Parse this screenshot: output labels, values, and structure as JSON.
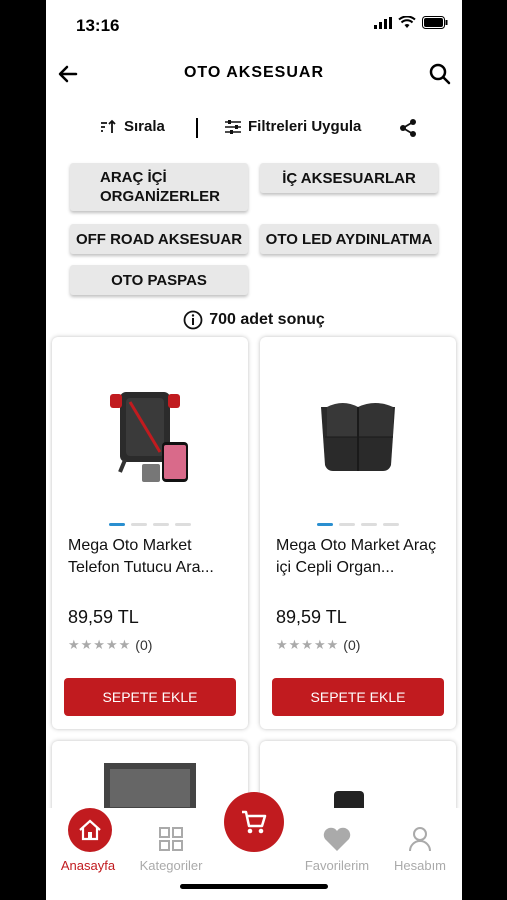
{
  "status": {
    "time": "13:16"
  },
  "header": {
    "title": "OTO AKSESUAR"
  },
  "toolbar": {
    "sort_label": "Sırala",
    "filter_label": "Filtreleri Uygula"
  },
  "categories": [
    {
      "label": "ARAÇ İÇİ ORGANİZERLER"
    },
    {
      "label": "İÇ AKSESUARLAR"
    },
    {
      "label": "OFF ROAD AKSESUAR"
    },
    {
      "label": "OTO LED AYDINLATMA"
    },
    {
      "label": "OTO PASPAS"
    }
  ],
  "results": {
    "text": "700 adet sonuç"
  },
  "products": [
    {
      "name": "Mega Oto Market Telefon Tutucu Ara...",
      "price": "89,59 TL",
      "rating_count": "(0)",
      "button": "SEPETE EKLE"
    },
    {
      "name": "Mega Oto Market Araç içi Cepli Organ...",
      "price": "89,59 TL",
      "rating_count": "(0)",
      "button": "SEPETE EKLE"
    }
  ],
  "tabbar": {
    "items": [
      {
        "label": "Anasayfa",
        "active": true
      },
      {
        "label": "Kategoriler"
      },
      {
        "label": "Favorilerim"
      },
      {
        "label": "Hesabım"
      }
    ]
  },
  "colors": {
    "accent": "#c11b1f",
    "dot_active": "#2a8fd0"
  },
  "icons": [
    "back-arrow-icon",
    "search-icon",
    "sort-icon",
    "filter-icon",
    "share-icon",
    "info-icon",
    "home-icon",
    "grid-icon",
    "cart-icon",
    "heart-icon",
    "user-icon"
  ]
}
